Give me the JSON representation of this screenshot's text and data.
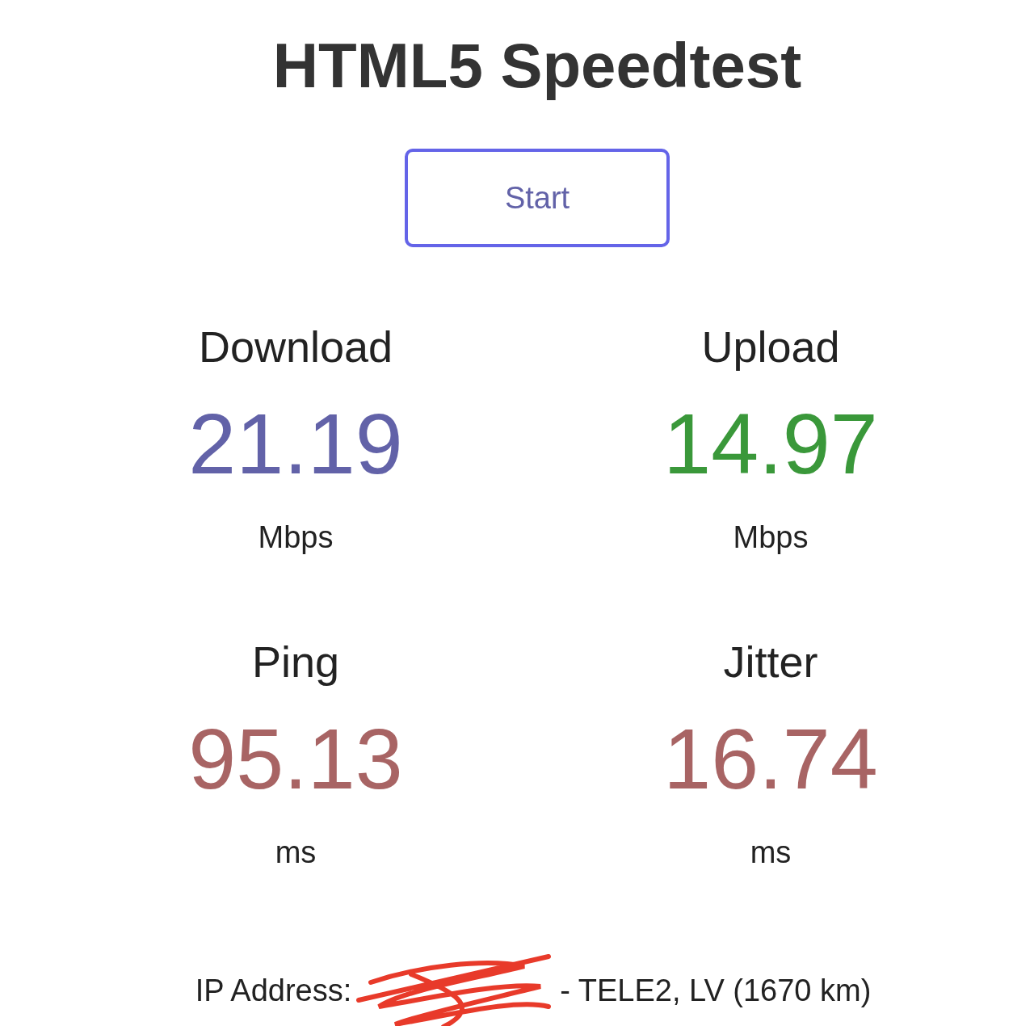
{
  "title": "HTML5 Speedtest",
  "start_button": {
    "label": "Start"
  },
  "metrics": [
    {
      "label": "Download",
      "value": "21.19",
      "unit": "Mbps",
      "color": "#6262a8"
    },
    {
      "label": "Upload",
      "value": "14.97",
      "unit": "Mbps",
      "color": "#3a983a"
    },
    {
      "label": "Ping",
      "value": "95.13",
      "unit": "ms",
      "color": "#a86464"
    },
    {
      "label": "Jitter",
      "value": "16.74",
      "unit": "ms",
      "color": "#a86464"
    }
  ],
  "ip_info": {
    "label": "IP Address:",
    "provider": "- TELE2, LV (1670 km)"
  }
}
